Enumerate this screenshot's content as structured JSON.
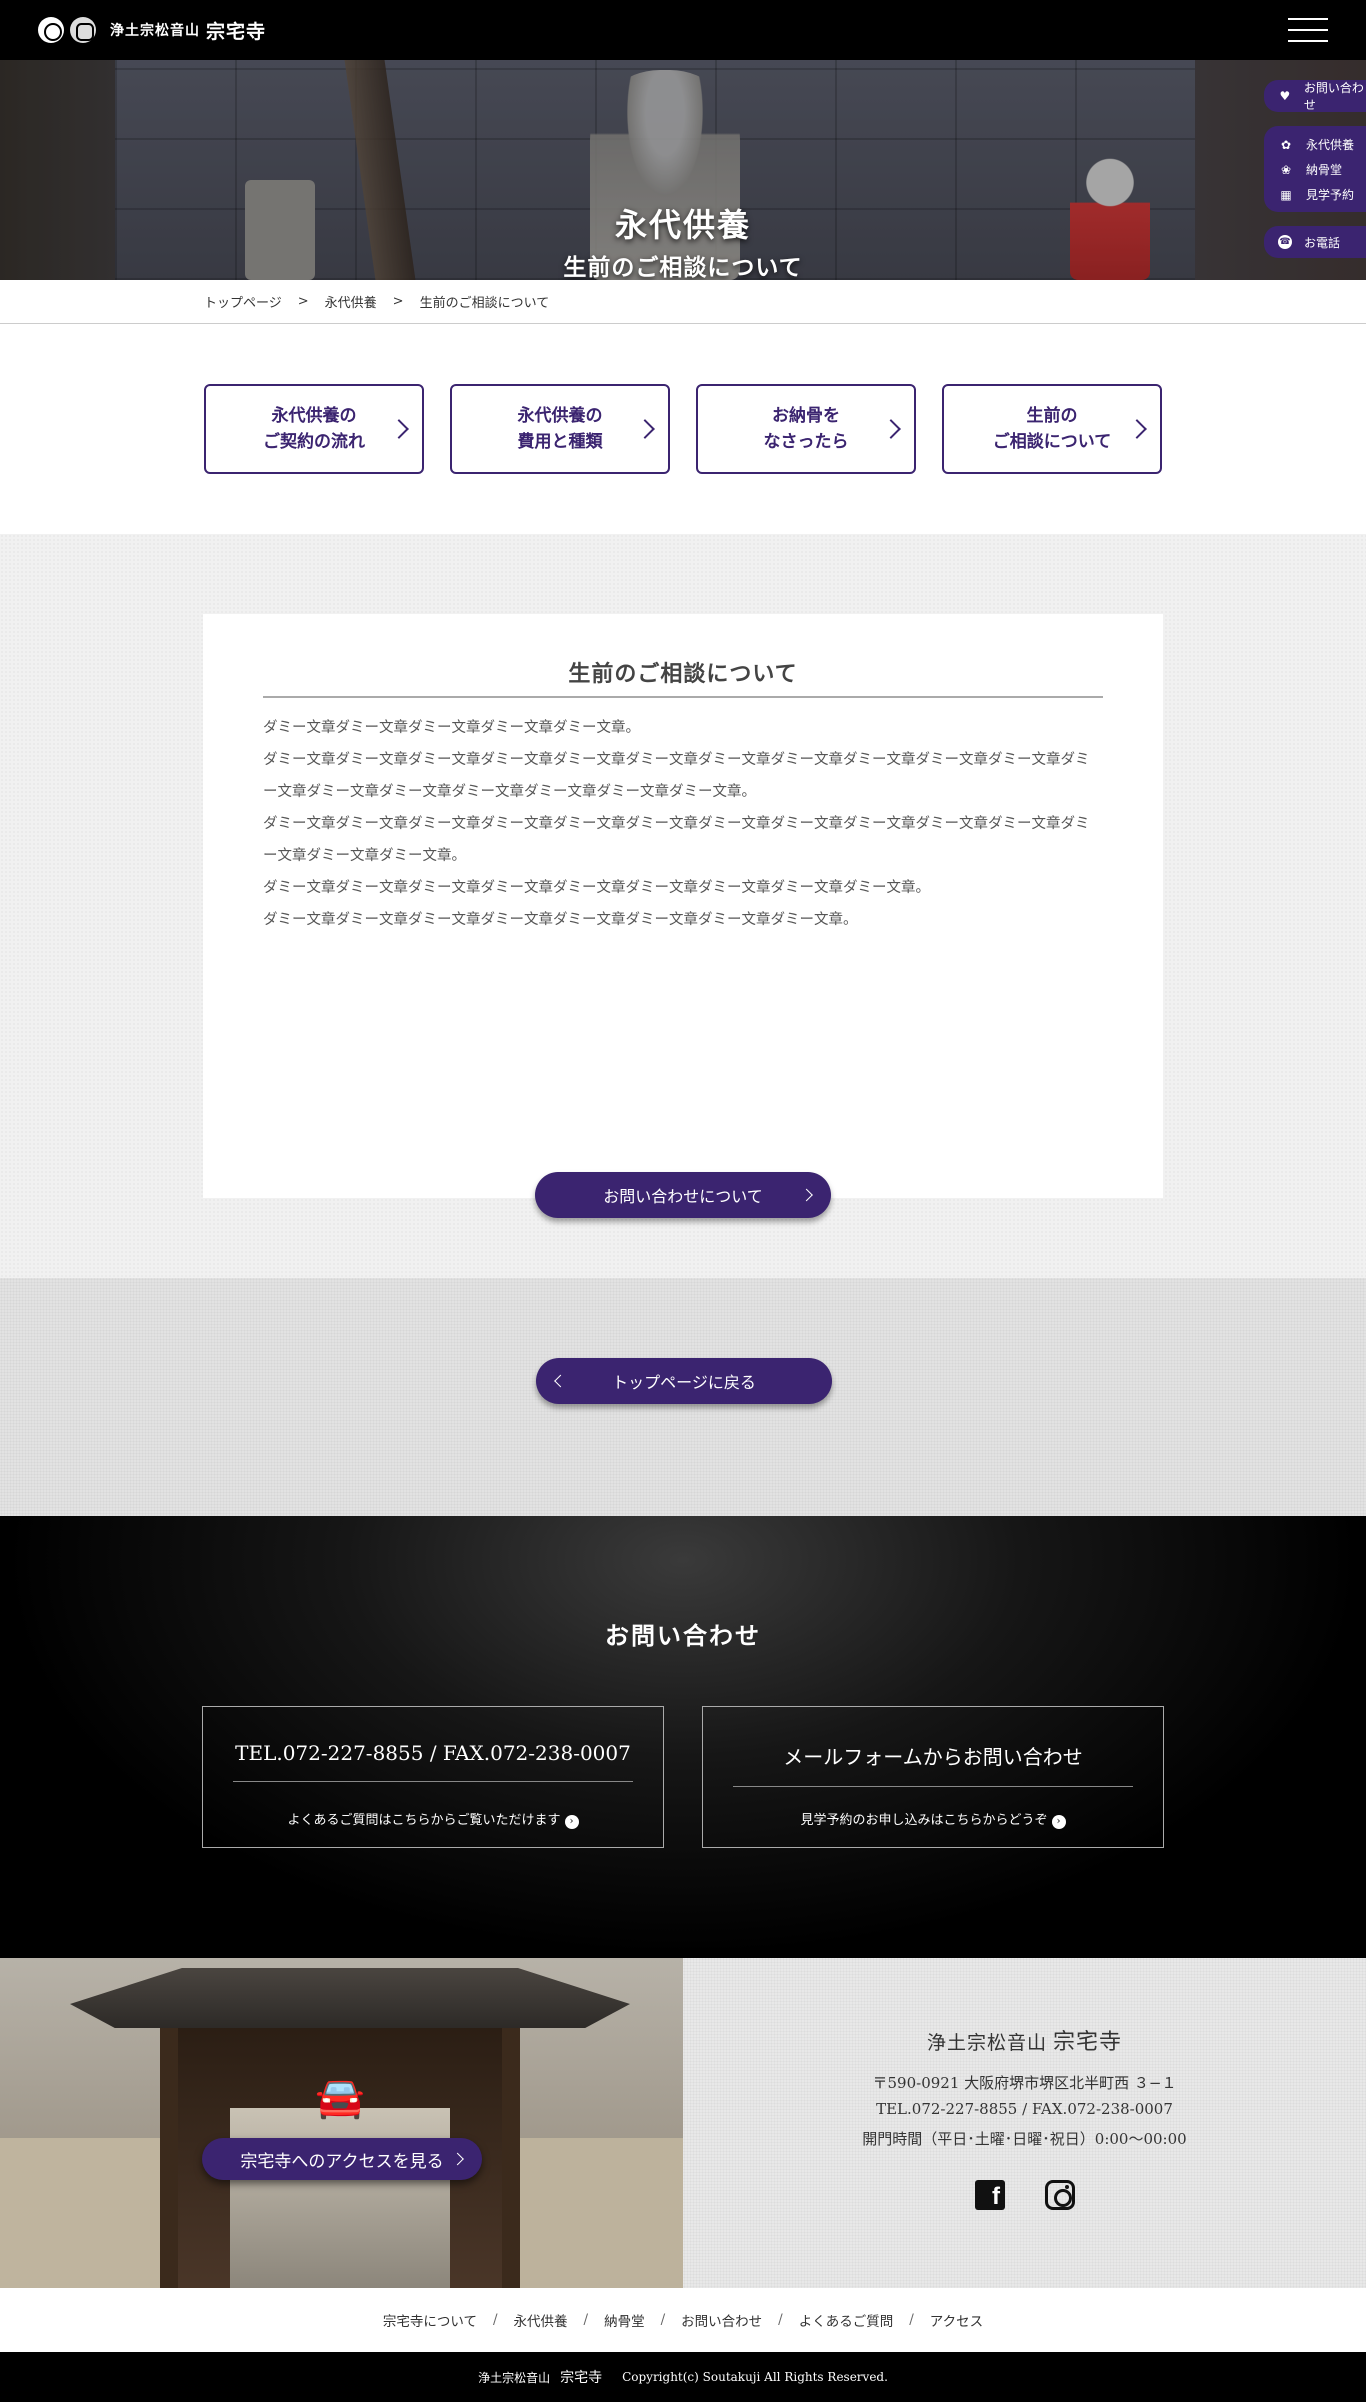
{
  "header": {
    "logo_sub": "浄土宗松音山",
    "logo_main": "宗宅寺"
  },
  "hero": {
    "title": "永代供養",
    "subtitle": "生前のご相談について"
  },
  "side_nav": {
    "contact": "お問い合わせ",
    "items": [
      {
        "label": "永代供養",
        "icon": "lotus-icon"
      },
      {
        "label": "納骨堂",
        "icon": "flower-icon"
      },
      {
        "label": "見学予約",
        "icon": "calendar-icon"
      }
    ],
    "tel": "お電話"
  },
  "breadcrumb": [
    "トップページ",
    "永代供養",
    "生前のご相談について"
  ],
  "breadcrumb_sep": ">",
  "subnav": [
    "永代供養の\nご契約の流れ",
    "永代供養の\n費用と種類",
    "お納骨を\nなさったら",
    "生前の\nご相談について"
  ],
  "content": {
    "title": "生前のご相談について",
    "paragraphs": [
      "ダミー文章ダミー文章ダミー文章ダミー文章ダミー文章。",
      "ダミー文章ダミー文章ダミー文章ダミー文章ダミー文章ダミー文章ダミー文章ダミー文章ダミー文章ダミー文章ダミー文章ダミー文章ダミー文章ダミー文章ダミー文章ダミー文章ダミー文章ダミー文章。",
      "ダミー文章ダミー文章ダミー文章ダミー文章ダミー文章ダミー文章ダミー文章ダミー文章ダミー文章ダミー文章ダミー文章ダミー文章ダミー文章ダミー文章。",
      "ダミー文章ダミー文章ダミー文章ダミー文章ダミー文章ダミー文章ダミー文章ダミー文章ダミー文章。",
      "ダミー文章ダミー文章ダミー文章ダミー文章ダミー文章ダミー文章ダミー文章ダミー文章。"
    ],
    "button": "お問い合わせについて"
  },
  "back_button": "トップページに戻る",
  "contact": {
    "title": "お問い合わせ",
    "tel_box": {
      "main": "TEL.072-227-8855 / FAX.072-238-0007",
      "sub": "よくあるご質問はこちらからご覧いただけます"
    },
    "mail_box": {
      "main": "メールフォームからお問い合わせ",
      "sub": "見学予約のお申し込みはこちらからどうぞ"
    }
  },
  "access": {
    "button": "宗宅寺へのアクセスを見る",
    "name_sub": "浄土宗松音山",
    "name_main": "宗宅寺",
    "address": "〒590-0921 大阪府堺市堺区北半町西 ３−１",
    "tel": "TEL.072-227-8855 / FAX.072-238-0007",
    "hours": "開門時間（平日･土曜･日曜･祝日）0:00〜00:00"
  },
  "footer_nav": [
    "宗宅寺について",
    "永代供養",
    "納骨堂",
    "お問い合わせ",
    "よくあるご質問",
    "アクセス"
  ],
  "footer_sep": "/",
  "copyright": {
    "brand_sub": "浄土宗松音山",
    "brand_main": "宗宅寺",
    "text": "Copyright(c) Soutakuji All Rights Reserved."
  },
  "colors": {
    "accent": "#3b2470",
    "header_bg": "#000000"
  }
}
